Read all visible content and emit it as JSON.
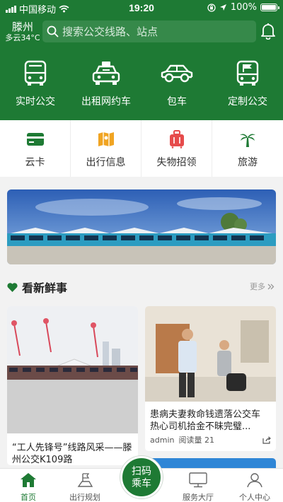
{
  "status_bar": {
    "carrier": "中国移动",
    "time": "19:20",
    "battery": "100%"
  },
  "header": {
    "city": "滕州",
    "weather": "多云34°C",
    "search_placeholder": "搜索公交线路、站点"
  },
  "quick_actions": [
    {
      "label": "实时公交",
      "icon": "bus-icon"
    },
    {
      "label": "出租网约车",
      "icon": "taxi-icon"
    },
    {
      "label": "包车",
      "icon": "car-icon"
    },
    {
      "label": "定制公交",
      "icon": "custom-bus-icon"
    }
  ],
  "services": [
    {
      "label": "云卡",
      "icon": "card-icon"
    },
    {
      "label": "出行信息",
      "icon": "map-icon"
    },
    {
      "label": "失物招领",
      "icon": "luggage-icon"
    },
    {
      "label": "旅游",
      "icon": "palm-tree-icon"
    }
  ],
  "news": {
    "title": "看新鲜事",
    "more": "更多",
    "items": [
      {
        "title": "“工人先锋号”线路风采——滕州公交K109路"
      },
      {
        "title": "患病夫妻救命钱遗落公交车 热心司机拾金不昧完璧...",
        "author": "admin",
        "reads": "阅读量 21"
      }
    ]
  },
  "tabbar": {
    "scan": {
      "line1": "扫码",
      "line2": "乘车"
    },
    "tabs": [
      {
        "label": "首页"
      },
      {
        "label": "出行规划"
      },
      {
        "label": "服务大厅"
      },
      {
        "label": "个人中心"
      }
    ]
  },
  "colors": {
    "primary": "#1e7a34",
    "search_bg": "#36894a",
    "card_yellow": "#f0a422",
    "card_red": "#e64b4b"
  }
}
